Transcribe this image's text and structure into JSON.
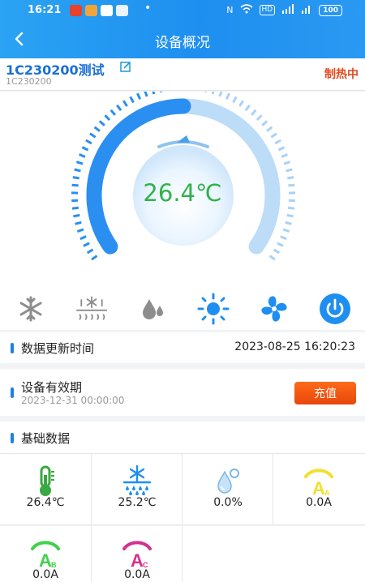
{
  "status_bar": {
    "time": "16:21",
    "battery": "100",
    "network_badge": "HD"
  },
  "header": {
    "title": "设备概况"
  },
  "device": {
    "name": "1C230200测试",
    "code": "1C230200",
    "status": "制热中"
  },
  "gauge": {
    "temperature": "26.4℃",
    "level": 0.5
  },
  "modes": [
    "snowflake-icon",
    "defrost-icon",
    "dehumidify-icon",
    "sun-icon",
    "fan-icon",
    "power-icon"
  ],
  "update_row": {
    "label": "数据更新时间",
    "value": "2023-08-25 16:20:23"
  },
  "validity_row": {
    "label": "设备有效期",
    "value": "2023-12-31 00:00:00",
    "button": "充值"
  },
  "basic_data": {
    "title": "基础数据",
    "items": [
      {
        "icon": "thermometer-icon",
        "value": "26.4℃"
      },
      {
        "icon": "snowflake-icon",
        "value": "25.2℃"
      },
      {
        "icon": "water-drop-icon",
        "value": "0.0%"
      },
      {
        "icon": "current-a-icon",
        "value": "0.0A"
      },
      {
        "icon": "current-b-icon",
        "value": "0.0A"
      },
      {
        "icon": "current-c-icon",
        "value": "0.0A"
      }
    ],
    "icon_letters": {
      "a": "A",
      "a_sub": "A",
      "b": "A",
      "b_sub": "B",
      "c": "A",
      "c_sub": "C"
    }
  },
  "colors": {
    "accent": "#1e8ff0",
    "heating": "#e04a1d",
    "temp_text": "#31b14a",
    "charge": "#f0591a"
  }
}
